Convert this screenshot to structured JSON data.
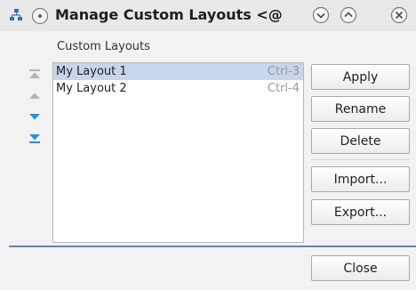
{
  "window": {
    "title": "Manage Custom Layouts <@"
  },
  "section_label": "Custom Layouts",
  "layouts": [
    {
      "name": "My Layout 1",
      "shortcut": "Ctrl-3",
      "selected": true
    },
    {
      "name": "My Layout 2",
      "shortcut": "Ctrl-4",
      "selected": false
    }
  ],
  "buttons": {
    "apply": "Apply",
    "rename": "Rename",
    "delete": "Delete",
    "import": "Import...",
    "export": "Export...",
    "close": "Close"
  },
  "colors": {
    "selection": "#c7d6ea",
    "accent_blue": "#2f8ed8",
    "disabled_gray": "#b4b4b4",
    "separator": "#5b87b8"
  },
  "icons": {
    "app": "network-icon",
    "pin": "pin-icon",
    "minimize": "chevron-down-icon",
    "maximize": "chevron-up-icon",
    "close": "close-icon",
    "move_top": "move-top-icon",
    "move_up": "move-up-icon",
    "move_down": "move-down-icon",
    "move_bottom": "move-bottom-icon"
  }
}
